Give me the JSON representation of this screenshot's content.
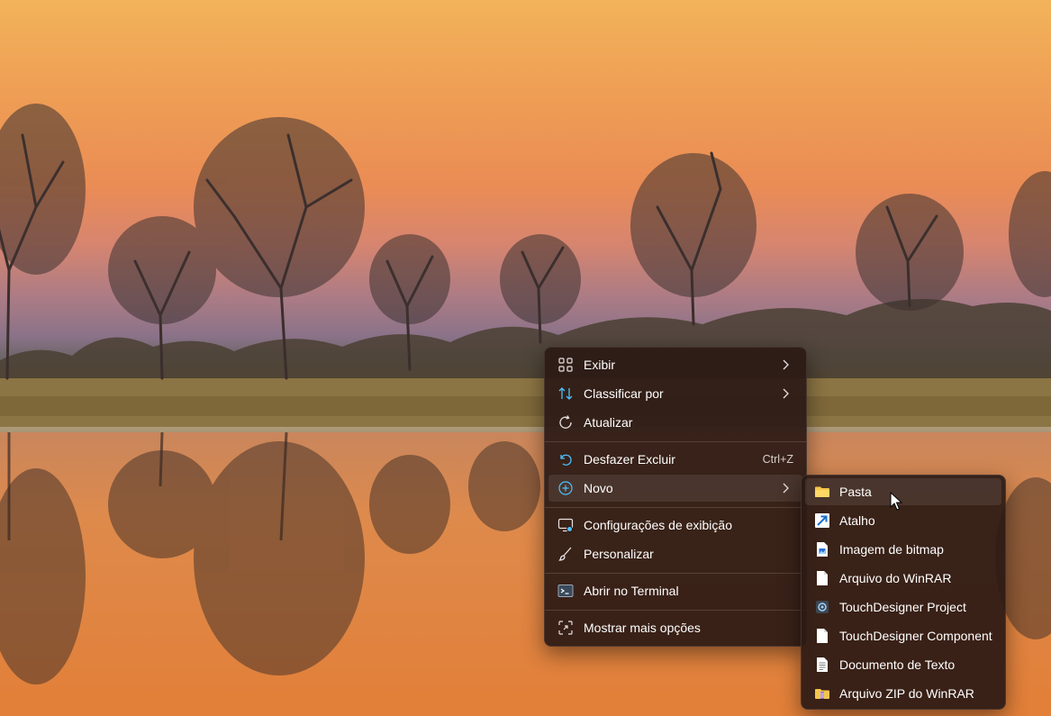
{
  "main_menu": {
    "items": [
      {
        "label": "Exibir",
        "icon": "grid-view-icon",
        "submenu": true
      },
      {
        "label": "Classificar por",
        "icon": "sort-arrows-icon",
        "submenu": true
      },
      {
        "label": "Atualizar",
        "icon": "refresh-icon"
      },
      {
        "label": "Desfazer Excluir",
        "icon": "undo-icon",
        "shortcut": "Ctrl+Z"
      },
      {
        "label": "Novo",
        "icon": "new-plus-circle-icon",
        "submenu": true,
        "highlighted": true
      },
      {
        "label": "Configurações de exibição",
        "icon": "display-settings-icon"
      },
      {
        "label": "Personalizar",
        "icon": "brush-icon"
      },
      {
        "label": "Abrir no Terminal",
        "icon": "terminal-icon"
      },
      {
        "label": "Mostrar mais opções",
        "icon": "more-options-icon"
      }
    ]
  },
  "new_submenu": {
    "items": [
      {
        "label": "Pasta",
        "icon": "folder-icon",
        "highlighted": true
      },
      {
        "label": "Atalho",
        "icon": "shortcut-arrow-icon"
      },
      {
        "label": "Imagem de bitmap",
        "icon": "bitmap-image-icon"
      },
      {
        "label": "Arquivo do WinRAR",
        "icon": "winrar-file-icon"
      },
      {
        "label": "TouchDesigner Project",
        "icon": "touchdesigner-project-icon"
      },
      {
        "label": "TouchDesigner Component",
        "icon": "touchdesigner-component-icon"
      },
      {
        "label": "Documento de Texto",
        "icon": "text-document-icon"
      },
      {
        "label": "Arquivo ZIP do WinRAR",
        "icon": "winrar-zip-icon"
      }
    ]
  },
  "colors": {
    "menu_bg": "#2c1a14",
    "accent": "#4cc2ff",
    "folder": "#f5c54a"
  }
}
